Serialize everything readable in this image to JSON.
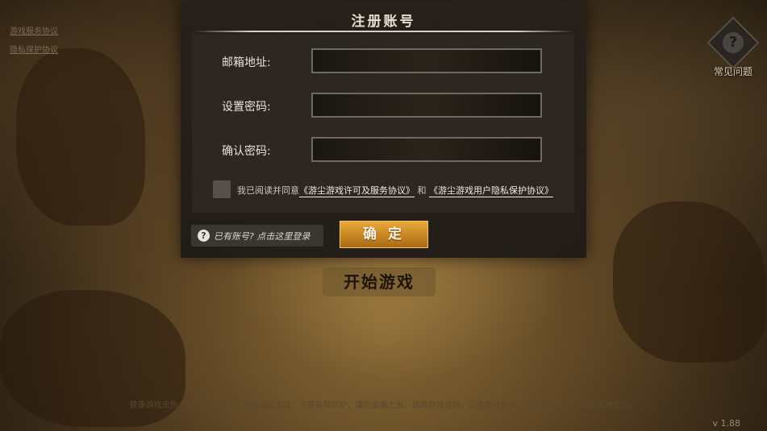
{
  "top_links": [
    "游戏服务协议",
    "隐私保护协议"
  ],
  "faq": {
    "icon": "question-icon",
    "glyph": "?",
    "label": "常见问题"
  },
  "start_button": "开始游戏",
  "disclaimer": "健康游戏忠告：抵制不良游戏，拒绝盗版游戏。注意自我保护，谨防受骗上当。适度游戏益脑，沉迷游戏伤身。合理安排时间，享受健康生活。",
  "version": "v 1.88",
  "dialog": {
    "title": "注册账号",
    "fields": [
      {
        "label": "邮箱地址:",
        "value": ""
      },
      {
        "label": "设置密码:",
        "value": ""
      },
      {
        "label": "确认密码:",
        "value": ""
      }
    ],
    "agreement": {
      "checked": false,
      "prefix": "我已阅读并同意",
      "link1": "《游尘游戏许可及服务协议》",
      "middle": "和",
      "link2": "《游尘游戏用户隐私保护协议》"
    },
    "login_hint": {
      "icon": "question-icon",
      "glyph": "?",
      "text": "已有账号? 点击这里登录"
    },
    "confirm_label": "确 定"
  },
  "colors": {
    "accent": "#d8952c",
    "panel": "#26201b"
  }
}
